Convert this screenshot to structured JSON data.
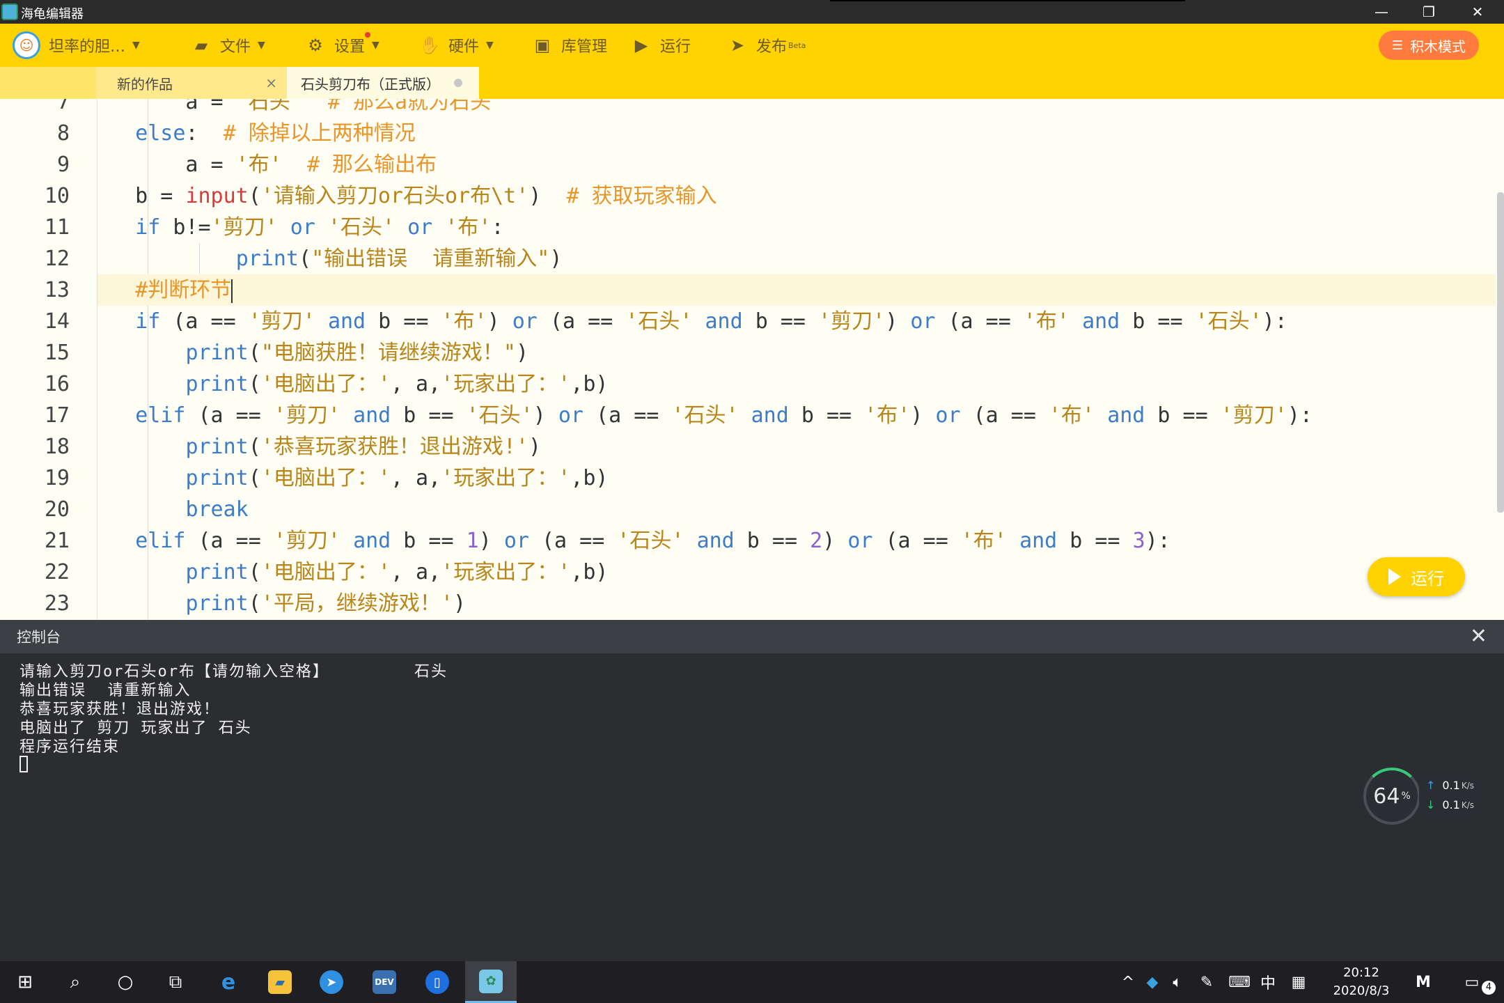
{
  "window": {
    "title": "海龟编辑器",
    "minimize": "—",
    "restore": "❐",
    "close": "✕"
  },
  "toolbar": {
    "user": "坦率的胆…",
    "file": "文件",
    "settings": "设置",
    "hardware": "硬件",
    "library": "库管理",
    "run": "运行",
    "publish": "发布",
    "publish_badge": "Beta",
    "block_mode": "积木模式"
  },
  "tabs": [
    {
      "label": "新的作品",
      "close": "×"
    },
    {
      "label": "石头剪刀布（正式版）"
    }
  ],
  "editor": {
    "line_numbers": [
      "7",
      "8",
      "9",
      "10",
      "11",
      "12",
      "13",
      "14",
      "15",
      "16",
      "17",
      "18",
      "19",
      "20",
      "21",
      "22",
      "23"
    ]
  },
  "run_button": "运行",
  "console": {
    "title": "控制台",
    "close": "✕",
    "lines": [
      "请输入剪刀or石头or布【请勿输入空格】        石头",
      "输出错误  请重新输入",
      "恭喜玩家获胜！退出游戏！",
      "电脑出了 剪刀 玩家出了 石头",
      "程序运行结束"
    ]
  },
  "netmon": {
    "percent": "64",
    "percent_unit": "%",
    "up": "0.1",
    "down": "0.1",
    "unit": "K/s"
  },
  "taskbar": {
    "ime": "中",
    "time": "20:12",
    "date": "2020/8/3",
    "notification_count": "4",
    "dev_label": "DEV"
  }
}
